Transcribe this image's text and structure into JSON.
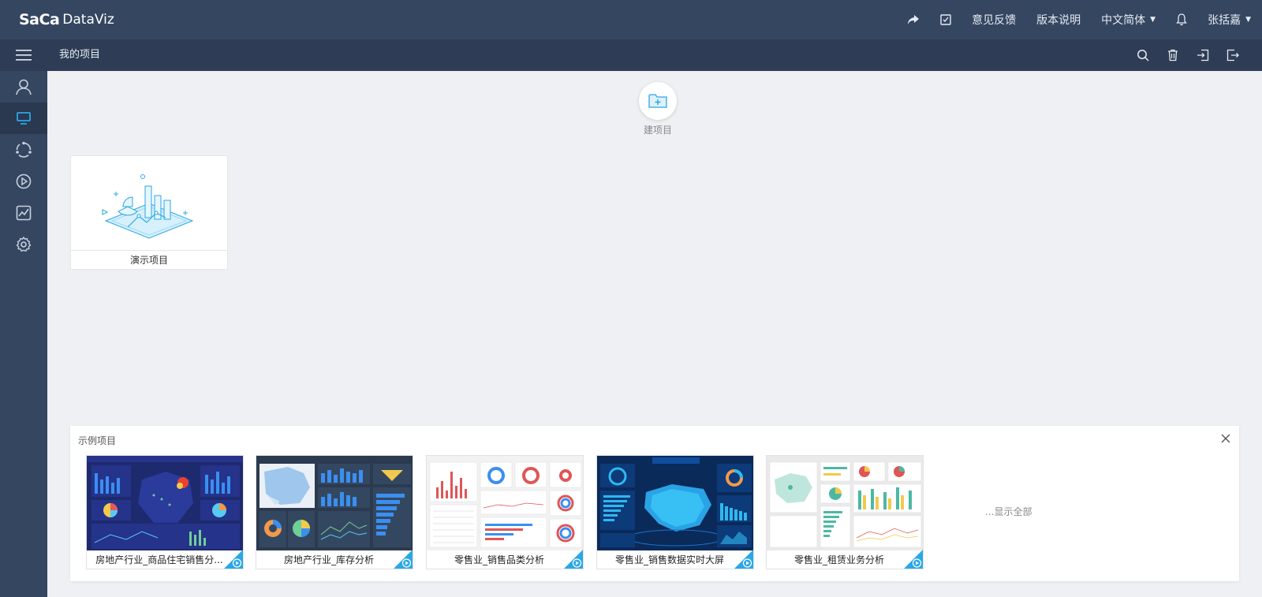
{
  "app": {
    "logo_bold": "SaCa",
    "logo_text": "DataViz"
  },
  "topnav": {
    "feedback": "意见反馈",
    "release_notes": "版本说明",
    "language": "中文简体",
    "user": "张括嘉"
  },
  "subbar": {
    "breadcrumb": "我的项目"
  },
  "main": {
    "new_project_label": "建项目",
    "projects": [
      {
        "name": "演示项目"
      }
    ]
  },
  "samples": {
    "title": "示例项目",
    "show_all": "...显示全部",
    "items": [
      {
        "name": "房地产行业_商品住宅销售分...",
        "theme": "#1e2a6e"
      },
      {
        "name": "房地产行业_库存分析",
        "theme": "#2b3a4f"
      },
      {
        "name": "零售业_销售品类分析",
        "theme": "#f2f2f2"
      },
      {
        "name": "零售业_销售数据实时大屏",
        "theme": "#0a2a5a"
      },
      {
        "name": "零售业_租赁业务分析",
        "theme": "#eaeaea"
      }
    ]
  },
  "colors": {
    "topbar": "#354661",
    "accent": "#2ba7e6"
  }
}
